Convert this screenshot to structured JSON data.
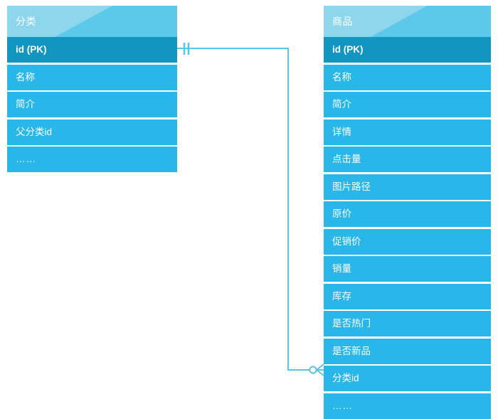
{
  "diagram": {
    "type": "er-diagram",
    "background_color": "#ffffff",
    "colors": {
      "header_light": "#8ed6ec",
      "header_accent": "#5cc9ea",
      "row": "#29b6e8",
      "row_primary_key": "#1296c0",
      "text": "#ffffff",
      "connector": "#5bc5e7"
    }
  },
  "entities": [
    {
      "id": "category",
      "title": "分类",
      "fields": [
        {
          "label": "id (PK)",
          "primary_key": true
        },
        {
          "label": "名称",
          "primary_key": false
        },
        {
          "label": "简介",
          "primary_key": false
        },
        {
          "label": "父分类id",
          "primary_key": false
        },
        {
          "label": "……",
          "primary_key": false
        }
      ]
    },
    {
      "id": "product",
      "title": "商品",
      "fields": [
        {
          "label": "id (PK)",
          "primary_key": true
        },
        {
          "label": "名称",
          "primary_key": false
        },
        {
          "label": "简介",
          "primary_key": false
        },
        {
          "label": "详情",
          "primary_key": false
        },
        {
          "label": "点击量",
          "primary_key": false
        },
        {
          "label": "图片路径",
          "primary_key": false
        },
        {
          "label": "原价",
          "primary_key": false
        },
        {
          "label": "促销价",
          "primary_key": false
        },
        {
          "label": "销量",
          "primary_key": false
        },
        {
          "label": "库存",
          "primary_key": false
        },
        {
          "label": "是否热门",
          "primary_key": false
        },
        {
          "label": "是否新品",
          "primary_key": false
        },
        {
          "label": "分类id",
          "primary_key": false
        },
        {
          "label": "……",
          "primary_key": false
        }
      ]
    }
  ],
  "relationship": {
    "from_entity": "category",
    "from_field": "id (PK)",
    "to_entity": "product",
    "to_field": "分类id",
    "from_cardinality": "exactly-one",
    "to_cardinality": "zero-or-many",
    "color": "#5bc5e7"
  }
}
